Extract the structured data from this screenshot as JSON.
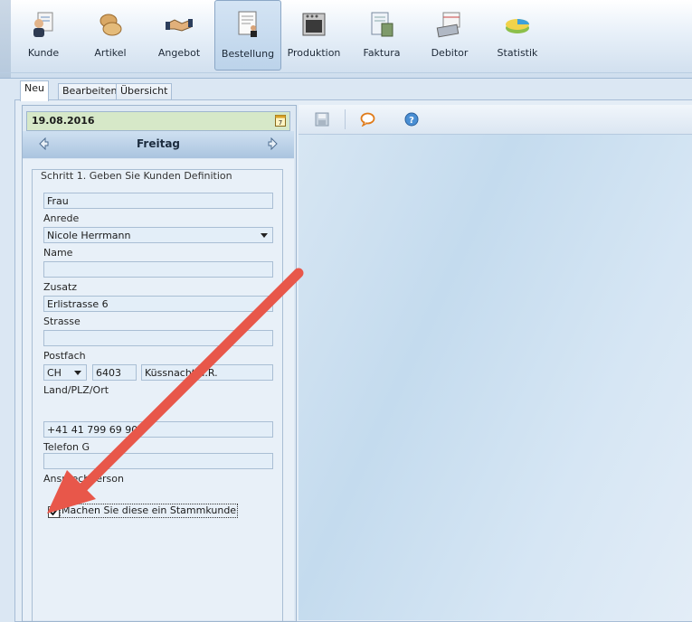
{
  "toolbar": {
    "items": [
      {
        "label": "Kunde",
        "icon": "customer-icon"
      },
      {
        "label": "Artikel",
        "icon": "article-icon"
      },
      {
        "label": "Angebot",
        "icon": "handshake-icon"
      },
      {
        "label": "Bestellung",
        "icon": "order-document-icon",
        "active": true
      },
      {
        "label": "Produktion",
        "icon": "oven-icon"
      },
      {
        "label": "Faktura",
        "icon": "invoice-calculator-icon"
      },
      {
        "label": "Debitor",
        "icon": "calendar-keyboard-icon"
      },
      {
        "label": "Statistik",
        "icon": "pie-chart-icon"
      }
    ]
  },
  "tabs": [
    {
      "label": "Neu",
      "active": true
    },
    {
      "label": "Bearbeiten"
    },
    {
      "label": "Übersicht"
    }
  ],
  "date": {
    "value": "19.08.2016",
    "weekday": "Freitag"
  },
  "form": {
    "legend": "Schritt 1. Geben Sie Kunden Definition",
    "anrede": {
      "value": "Frau",
      "label": "Anrede"
    },
    "name": {
      "value": "Nicole Herrmann",
      "label": "Name"
    },
    "zusatz": {
      "value": "",
      "label": "Zusatz"
    },
    "strasse": {
      "value": "Erlistrasse 6",
      "label": "Strasse"
    },
    "postfach": {
      "value": "",
      "label": "Postfach"
    },
    "country": {
      "value": "CH"
    },
    "plz": {
      "value": "6403"
    },
    "ort": {
      "value": "Küssnacht a.R."
    },
    "location_label": "Land/PLZ/Ort",
    "telefon": {
      "value": "+41 41 799 69 90",
      "label": "Telefon G"
    },
    "ansprechperson": {
      "value": "",
      "label": "Ansprechperson"
    },
    "stammkunde": {
      "label": "Machen Sie diese ein Stammkunde",
      "checked": true
    }
  },
  "right_toolbar": {
    "icons": [
      "save-icon",
      "comment-icon",
      "help-icon"
    ]
  },
  "colors": {
    "annotation_arrow": "#e8574a",
    "date_bg": "#d6e8c8"
  }
}
